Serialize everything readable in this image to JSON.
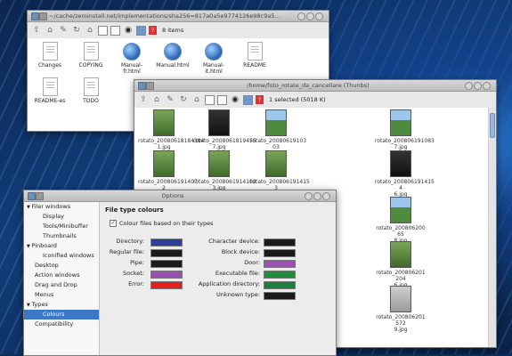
{
  "colors": {
    "accent": "#3d78c7",
    "directory": "#2c3f9a",
    "regular": "#1a1a1a",
    "pipe": "#1a1a1a",
    "socket": "#9a4fb2",
    "error": "#e02020",
    "char": "#1a1a1a",
    "block": "#1a1a1a",
    "door": "#9a4fb2",
    "exec": "#1e8c3a",
    "appdir": "#1e7d3a",
    "unknown": "#1a1a1a"
  },
  "win1": {
    "title": "~/cache/zeroinstall.net/implementations/sha256=817a0a5e9774126e98c9a5...",
    "toolbar_count": "8 items",
    "files": [
      {
        "label": "Changes",
        "kind": "doc"
      },
      {
        "label": "COPYING",
        "kind": "doc"
      },
      {
        "label": "Manual-fr.html",
        "kind": "globe"
      },
      {
        "label": "Manual.html",
        "kind": "globe"
      },
      {
        "label": "Manual-it.html",
        "kind": "globe"
      },
      {
        "label": "README",
        "kind": "doc"
      },
      {
        "label": "README-es",
        "kind": "doc"
      },
      {
        "label": "TODO",
        "kind": "doc"
      }
    ]
  },
  "win2": {
    "title": "/home/foto_rotate_da_cancellare (Thunbs)",
    "toolbar_status": "1 selected (5018 K)",
    "thumbs": [
      {
        "l1": "rotato_20080618184394",
        "l2": "1.jpg"
      },
      {
        "l1": "rotato_2008061819455",
        "l2": "7.jpg"
      },
      {
        "l1": "rotato_20080619103 03",
        "l2": "6.jpg"
      },
      {
        "l1": "rotato_200806191083",
        "l2": "7.jpg"
      },
      {
        "l1": "rotato_200806191407 2",
        "l2": "1.jpg"
      },
      {
        "l1": "rotato_2008061914102",
        "l2": "3.jpg"
      },
      {
        "l1": "rotato_200806191415 3",
        "l2": "8.jpg"
      },
      {
        "l1": "rotato_200806191415 4",
        "l2": "6.jpg"
      },
      {
        "l1": "017530",
        "l2": ""
      },
      {
        "l1": "rotato_200806200 65",
        "l2": "8.jpg"
      },
      {
        "l1": "011204",
        "l2": ""
      },
      {
        "l1": "rotato_200806201 204",
        "l2": "6.jpg"
      },
      {
        "l1": "014185",
        "l2": ""
      },
      {
        "l1": "rotato_200806201 572",
        "l2": "9.jpg"
      }
    ]
  },
  "options": {
    "title": "Options",
    "sidebar": [
      {
        "label": "Filer windows",
        "indent": 0,
        "arrow": "▼"
      },
      {
        "label": "Display",
        "indent": 2,
        "arrow": ""
      },
      {
        "label": "Tools/Minibuffer",
        "indent": 2,
        "arrow": ""
      },
      {
        "label": "Thumbnails",
        "indent": 2,
        "arrow": ""
      },
      {
        "label": "Pinboard",
        "indent": 0,
        "arrow": "▼"
      },
      {
        "label": "Iconified windows",
        "indent": 2,
        "arrow": ""
      },
      {
        "label": "Desktop",
        "indent": 1,
        "arrow": ""
      },
      {
        "label": "Action windows",
        "indent": 1,
        "arrow": ""
      },
      {
        "label": "Drag and Drop",
        "indent": 1,
        "arrow": ""
      },
      {
        "label": "Menus",
        "indent": 1,
        "arrow": ""
      },
      {
        "label": "Types",
        "indent": 0,
        "arrow": "▼"
      },
      {
        "label": "Colours",
        "indent": 2,
        "arrow": "",
        "selected": true
      },
      {
        "label": "Compatibility",
        "indent": 1,
        "arrow": ""
      }
    ],
    "heading": "File type colours",
    "checkbox_label": "Colour files based on their types",
    "checkbox_mark": "✓",
    "left_types": [
      "Directory:",
      "Regular file:",
      "Pipe:",
      "Socket:",
      "Error:"
    ],
    "right_types": [
      "Character device:",
      "Block device:",
      "Door:",
      "Executable file:",
      "Application directory:",
      "Unknown type:"
    ]
  }
}
